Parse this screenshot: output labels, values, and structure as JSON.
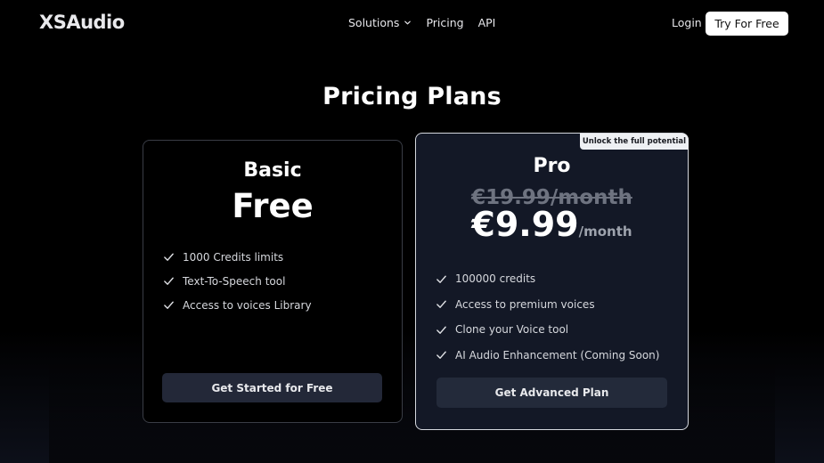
{
  "nav": {
    "logo": "XSAudio",
    "links": [
      "Solutions",
      "Pricing",
      "API"
    ],
    "login": "Login",
    "cta": "Try For Free"
  },
  "page": {
    "title": "Pricing Plans"
  },
  "plans": {
    "basic": {
      "name": "Basic",
      "price": "Free",
      "features": [
        "1000 Credits limits",
        "Text-To-Speech tool",
        "Access to voices Library"
      ],
      "button": "Get Started for Free"
    },
    "pro": {
      "badge": "Unlock the full potential",
      "name": "Pro",
      "old_price": "€19.99/month",
      "price": "€9.99",
      "period": "/month",
      "features": [
        "100000 credits",
        "Access to premium voices",
        "Clone your Voice tool",
        "AI Audio Enhancement (Coming Soon)"
      ],
      "button": "Get Advanced Plan"
    }
  },
  "icons": {
    "chevron": "chevron-down-icon",
    "check": "check-icon"
  },
  "colors": {
    "background": "#000000",
    "pro_card": "#131826",
    "button": "#232838",
    "accent_light": "#ffffff"
  }
}
